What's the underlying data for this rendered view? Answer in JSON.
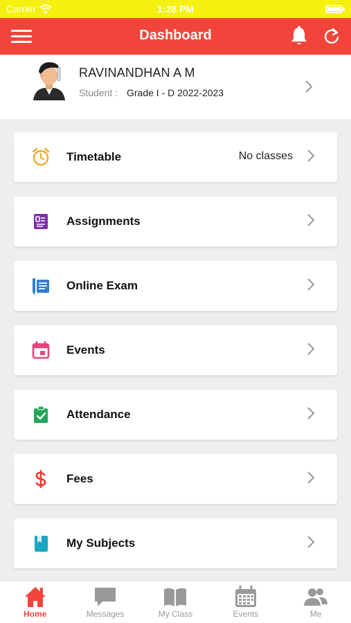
{
  "status_bar": {
    "carrier": "Carrier",
    "time": "1:28 PM",
    "battery_level": 1.0
  },
  "header": {
    "title": "Dashboard"
  },
  "profile": {
    "name": "RAVINANDHAN A M",
    "role_label": "Student :",
    "grade": "Grade I - D 2022-2023"
  },
  "menu": [
    {
      "label": "Timetable",
      "value": "No classes",
      "icon": "alarm-clock-icon",
      "color": "#f5a623"
    },
    {
      "label": "Assignments",
      "value": "",
      "icon": "assignment-icon",
      "color": "#7b2fa8"
    },
    {
      "label": "Online Exam",
      "value": "",
      "icon": "online-exam-icon",
      "color": "#2f7fd1"
    },
    {
      "label": "Events",
      "value": "",
      "icon": "calendar-icon",
      "color": "#e8457a"
    },
    {
      "label": "Attendance",
      "value": "",
      "icon": "clipboard-check-icon",
      "color": "#22a65a"
    },
    {
      "label": "Fees",
      "value": "",
      "icon": "dollar-icon",
      "color": "#e8392f"
    },
    {
      "label": "My Subjects",
      "value": "",
      "icon": "book-icon",
      "color": "#1aa7c4"
    }
  ],
  "tabs": [
    {
      "label": "Home",
      "icon": "home-icon",
      "active": true
    },
    {
      "label": "Messages",
      "icon": "message-icon",
      "active": false
    },
    {
      "label": "My Class",
      "icon": "open-book-icon",
      "active": false
    },
    {
      "label": "Events",
      "icon": "calendar-icon",
      "active": false
    },
    {
      "label": "Me",
      "icon": "people-icon",
      "active": false
    }
  ],
  "colors": {
    "accent": "#f1453b",
    "status_bar": "#f5f010",
    "inactive_tab": "#999999"
  }
}
